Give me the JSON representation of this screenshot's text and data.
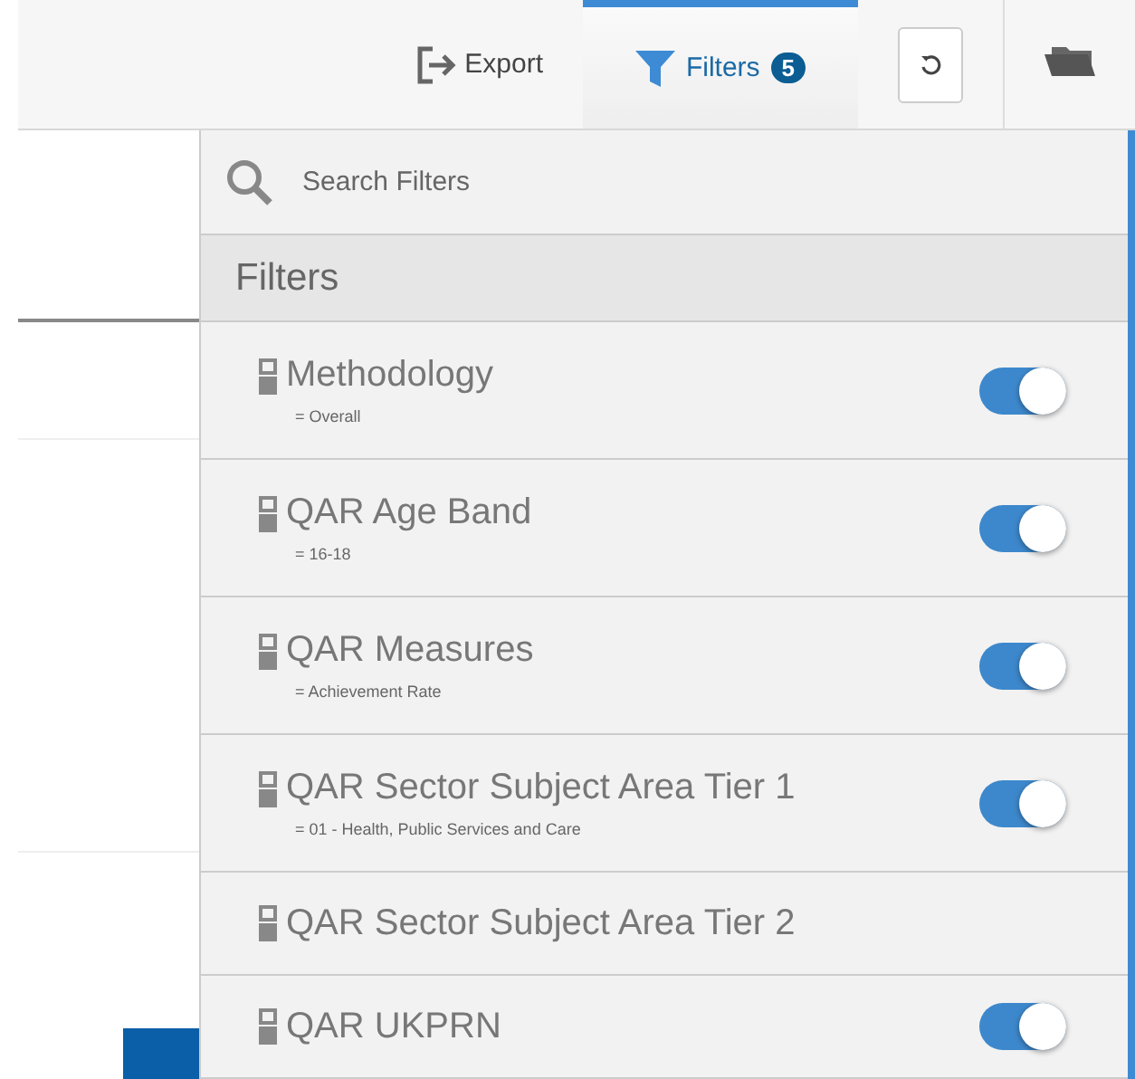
{
  "toolbar": {
    "export_label": "Export",
    "filters_tab": {
      "label": "Filters",
      "count": "5",
      "selected": true
    }
  },
  "search": {
    "placeholder": "Search Filters"
  },
  "panel_title": "Filters",
  "filters": [
    {
      "name": "Methodology",
      "value": "= Overall",
      "on": true
    },
    {
      "name": "QAR Age Band",
      "value": "= 16-18",
      "on": true
    },
    {
      "name": "QAR Measures",
      "value": "= Achievement Rate",
      "on": true
    },
    {
      "name": "QAR Sector Subject Area Tier 1",
      "value": "= 01 - Health, Public Services and Care",
      "on": true
    },
    {
      "name": "QAR Sector Subject Area Tier 2",
      "on": false
    },
    {
      "name": "QAR UKPRN",
      "on": true
    }
  ]
}
